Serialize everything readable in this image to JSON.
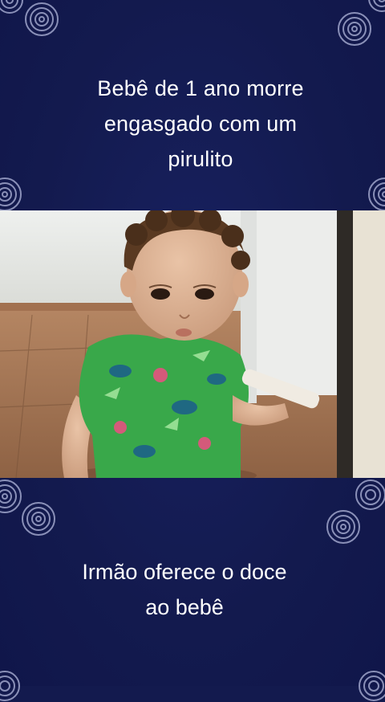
{
  "headline": "Bebê de 1 ano morre\nengasgado com um\npirulito",
  "caption": "Irmão oferece o doce\nao bebê",
  "photo": {
    "subject": "toddler-holding-lollipop-icon"
  },
  "colors": {
    "background": "#131a4e",
    "text": "#ffffff",
    "ornament": "#8a90b8"
  }
}
